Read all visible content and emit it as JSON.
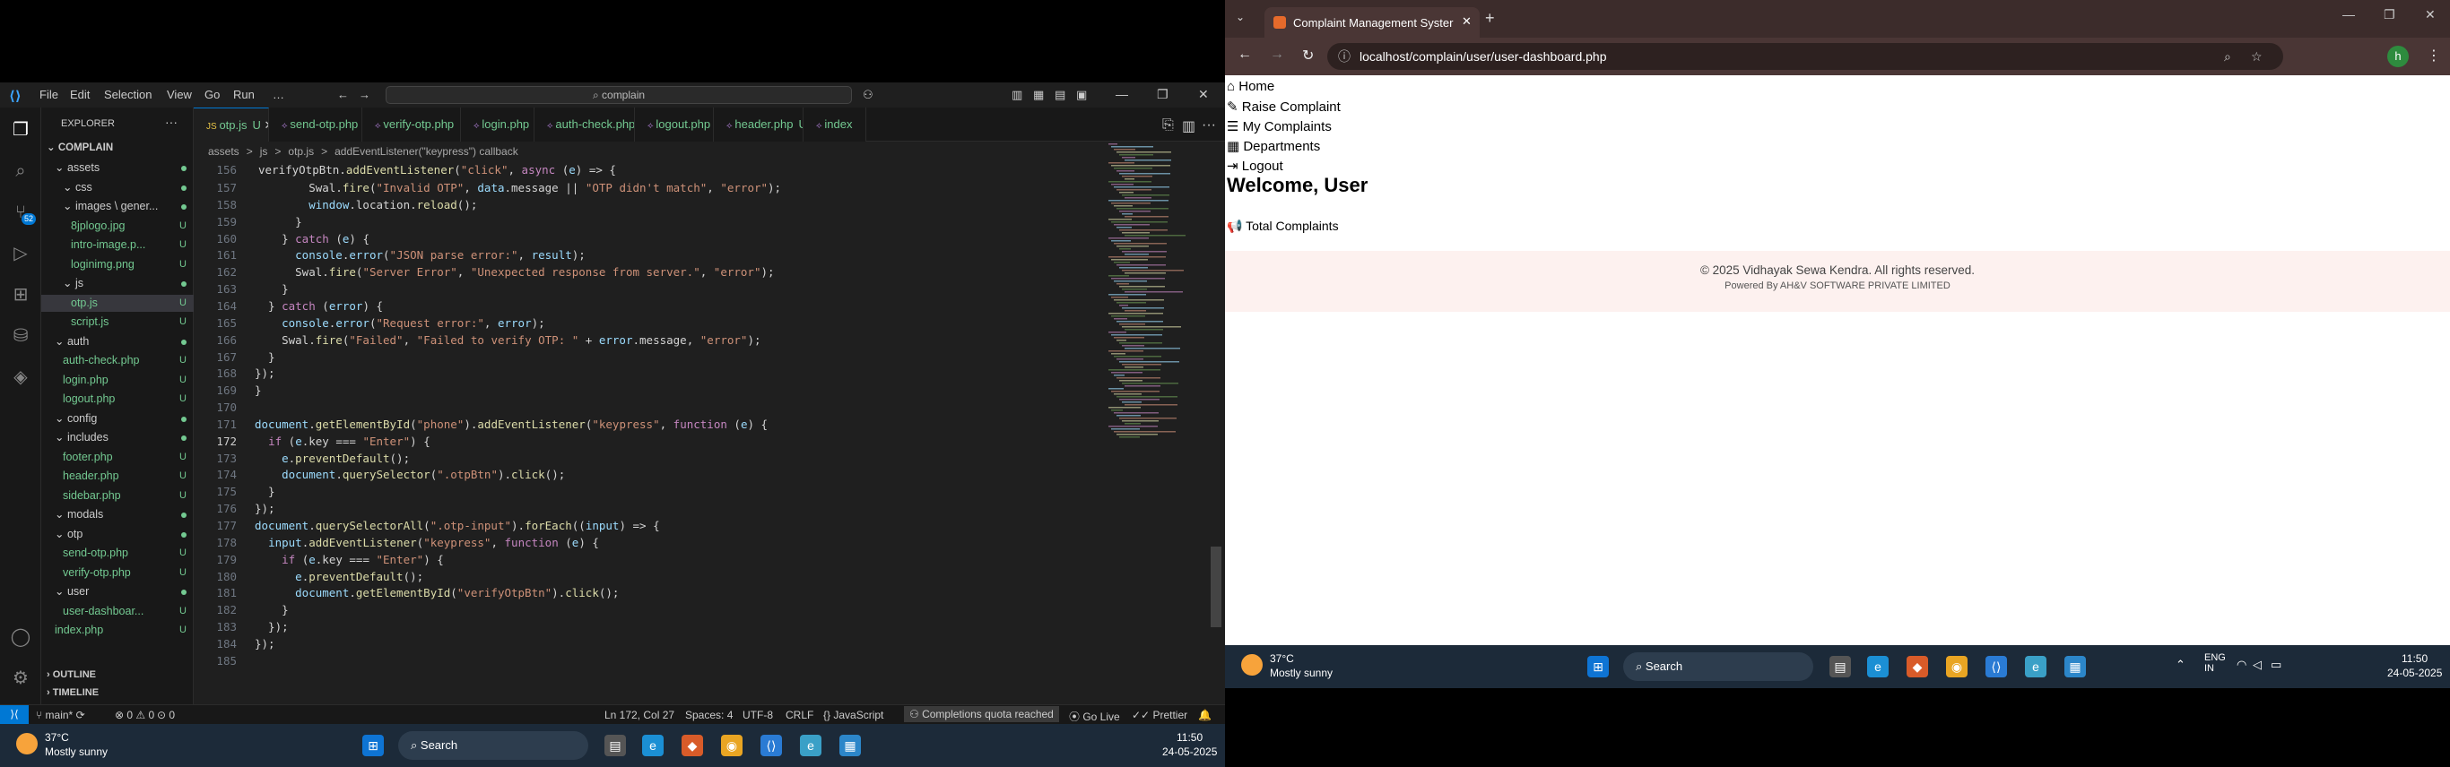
{
  "vscode": {
    "menus": [
      "File",
      "Edit",
      "Selection",
      "View",
      "Go",
      "Run",
      "…"
    ],
    "search_text": "complain",
    "explorer": {
      "header": "EXPLORER",
      "root": "COMPLAIN",
      "items": [
        {
          "label": "assets",
          "kind": "folder",
          "status": ""
        },
        {
          "label": "css",
          "kind": "folder",
          "status": ""
        },
        {
          "label": "images \\ gener...",
          "kind": "folder",
          "status": ""
        },
        {
          "label": "8jplogo.jpg",
          "kind": "file",
          "status": "U"
        },
        {
          "label": "intro-image.p...",
          "kind": "file",
          "status": "U"
        },
        {
          "label": "loginimg.png",
          "kind": "file",
          "status": "U"
        },
        {
          "label": "js",
          "kind": "folder",
          "status": ""
        },
        {
          "label": "otp.js",
          "kind": "file",
          "status": "U"
        },
        {
          "label": "script.js",
          "kind": "file",
          "status": "U"
        },
        {
          "label": "auth",
          "kind": "folder",
          "status": ""
        },
        {
          "label": "auth-check.php",
          "kind": "file",
          "status": "U"
        },
        {
          "label": "login.php",
          "kind": "file",
          "status": "U"
        },
        {
          "label": "logout.php",
          "kind": "file",
          "status": "U"
        },
        {
          "label": "config",
          "kind": "folder",
          "status": ""
        },
        {
          "label": "includes",
          "kind": "folder",
          "status": ""
        },
        {
          "label": "footer.php",
          "kind": "file",
          "status": "U"
        },
        {
          "label": "header.php",
          "kind": "file",
          "status": "U"
        },
        {
          "label": "sidebar.php",
          "kind": "file",
          "status": "U"
        },
        {
          "label": "modals",
          "kind": "folder",
          "status": ""
        },
        {
          "label": "otp",
          "kind": "folder",
          "status": ""
        },
        {
          "label": "send-otp.php",
          "kind": "file",
          "status": "U"
        },
        {
          "label": "verify-otp.php",
          "kind": "file",
          "status": "U"
        },
        {
          "label": "user",
          "kind": "folder",
          "status": ""
        },
        {
          "label": "user-dashboar...",
          "kind": "file",
          "status": "U"
        },
        {
          "label": "index.php",
          "kind": "file",
          "status": "U"
        }
      ],
      "outline": "OUTLINE",
      "timeline": "TIMELINE"
    },
    "tabs": [
      "otp.js",
      "send-otp.php",
      "verify-otp.php",
      "login.php",
      "auth-check.php",
      "logout.php",
      "header.php",
      "index"
    ],
    "tab_status": "U",
    "breadcrumb": [
      "assets",
      ">",
      "js",
      ">",
      "otp.js",
      ">",
      "addEventListener(\"keypress\") callback"
    ],
    "sticky_line": {
      "num": "156",
      "text": "verifyOtpBtn.addEventListener(\"click\", async (e) => {"
    },
    "lines": [
      {
        "num": "157",
        "text": "        Swal.fire(\"Invalid OTP\", data.message || \"OTP didn't match\", \"error\");"
      },
      {
        "num": "158",
        "text": "        window.location.reload();"
      },
      {
        "num": "159",
        "text": "      }"
      },
      {
        "num": "160",
        "text": "    } catch (e) {"
      },
      {
        "num": "161",
        "text": "      console.error(\"JSON parse error:\", result);"
      },
      {
        "num": "162",
        "text": "      Swal.fire(\"Server Error\", \"Unexpected response from server.\", \"error\");"
      },
      {
        "num": "163",
        "text": "    }"
      },
      {
        "num": "164",
        "text": "  } catch (error) {"
      },
      {
        "num": "165",
        "text": "    console.error(\"Request error:\", error);"
      },
      {
        "num": "166",
        "text": "    Swal.fire(\"Failed\", \"Failed to verify OTP: \" + error.message, \"error\");"
      },
      {
        "num": "167",
        "text": "  }"
      },
      {
        "num": "168",
        "text": "});"
      },
      {
        "num": "169",
        "text": "}"
      },
      {
        "num": "170",
        "text": ""
      },
      {
        "num": "171",
        "text": "document.getElementById(\"phone\").addEventListener(\"keypress\", function (e) {"
      },
      {
        "num": "172",
        "text": "  if (e.key === \"Enter\") {"
      },
      {
        "num": "173",
        "text": "    e.preventDefault();"
      },
      {
        "num": "174",
        "text": "    document.querySelector(\".otpBtn\").click();"
      },
      {
        "num": "175",
        "text": "  }"
      },
      {
        "num": "176",
        "text": "});"
      },
      {
        "num": "177",
        "text": "document.querySelectorAll(\".otp-input\").forEach((input) => {"
      },
      {
        "num": "178",
        "text": "  input.addEventListener(\"keypress\", function (e) {"
      },
      {
        "num": "179",
        "text": "    if (e.key === \"Enter\") {"
      },
      {
        "num": "180",
        "text": "      e.preventDefault();"
      },
      {
        "num": "181",
        "text": "      document.getElementById(\"verifyOtpBtn\").click();"
      },
      {
        "num": "182",
        "text": "    }"
      },
      {
        "num": "183",
        "text": "  });"
      },
      {
        "num": "184",
        "text": "});"
      },
      {
        "num": "185",
        "text": ""
      }
    ],
    "statusbar": {
      "branch": "main*",
      "problems": "⊗ 0 ⚠ 0",
      "warnings_extra": "0",
      "position": "Ln 172, Col 27",
      "spaces": "Spaces: 4",
      "encoding": "UTF-8",
      "eol": "CRLF",
      "language": "JavaScript",
      "copilot": "Completions quota reached",
      "golive": "Go Live",
      "prettier": "Prettier"
    },
    "badge": "52"
  },
  "taskbar": {
    "weather_temp": "37°C",
    "weather_desc": "Mostly sunny",
    "search": "Search",
    "time": "11:50",
    "date": "24-05-2025",
    "lang": "ENG",
    "region": "IN"
  },
  "chrome": {
    "tab_title": "Complaint Management Syster",
    "url": "localhost/complain/user/user-dashboard.php",
    "avatar_letter": "h"
  },
  "page": {
    "nav": [
      "Home",
      "Raise Complaint",
      "My Complaints",
      "Departments",
      "Logout"
    ],
    "welcome": "Welcome, User",
    "total_label": "Total Complaints",
    "footer_copy": "© 2025 Vidhayak Sewa Kendra. All rights reserved.",
    "footer_powered": "Powered By AH&V SOFTWARE PRIVATE LIMITED"
  }
}
